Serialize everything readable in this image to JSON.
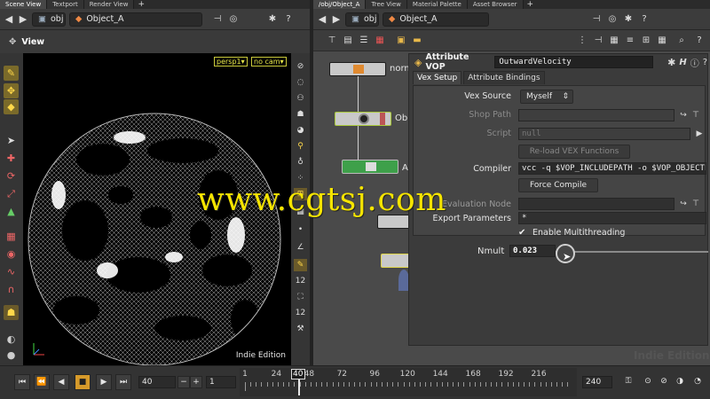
{
  "left_tabs": [
    "Scene View",
    "Textport",
    "Render View"
  ],
  "right_tabs": [
    "/obj/Object_A",
    "Tree View",
    "Material Palette",
    "Asset Browser"
  ],
  "left_path": {
    "context": "obj",
    "object": "Object_A"
  },
  "right_path": {
    "context": "obj",
    "object": "Object_A"
  },
  "viewport": {
    "title": "View",
    "camera": "persp1",
    "cam_menu": "no cam",
    "edition": "Indie Edition"
  },
  "network": {
    "nodes": [
      {
        "label": "norm",
        "color": "#c9c9c9"
      },
      {
        "label": "Ob",
        "color": "#c9c9c9"
      },
      {
        "label": "A",
        "color": "#3ea04a"
      }
    ]
  },
  "params": {
    "node_type": "Attribute VOP",
    "node_name": "OutwardVelocity",
    "tabs": [
      "Vex Setup",
      "Attribute Bindings"
    ],
    "vex_source_label": "Vex Source",
    "vex_source_value": "Myself",
    "shop_path_label": "Shop Path",
    "script_label": "Script",
    "script_placeholder": "null",
    "reload_button": "Re-load VEX Functions",
    "compiler_label": "Compiler",
    "compiler_value": "vcc -q $VOP_INCLUDEPATH -o $VOP_OBJECTFI",
    "force_compile_button": "Force Compile",
    "evaluation_label": "Evaluation Node",
    "export_label": "Export Parameters",
    "export_value": "*",
    "multithreading_label": "Enable Multithreading",
    "multithreading_checked": true,
    "nmult_label": "Nmult",
    "nmult_value": "0.023",
    "edition": "Indie Edition"
  },
  "watermark": "www.cgtsj.com",
  "timeline": {
    "frame": "40",
    "step": "1",
    "range_end": "240",
    "ruler_ticks": [
      "1",
      "24",
      "40",
      "48",
      "72",
      "96",
      "120",
      "144",
      "168",
      "192",
      "216"
    ],
    "current_frame": "40",
    "current_frame_fraction": 0.163
  },
  "colors": {
    "accent": "#d69a2a",
    "watermark": "#f5e400"
  }
}
